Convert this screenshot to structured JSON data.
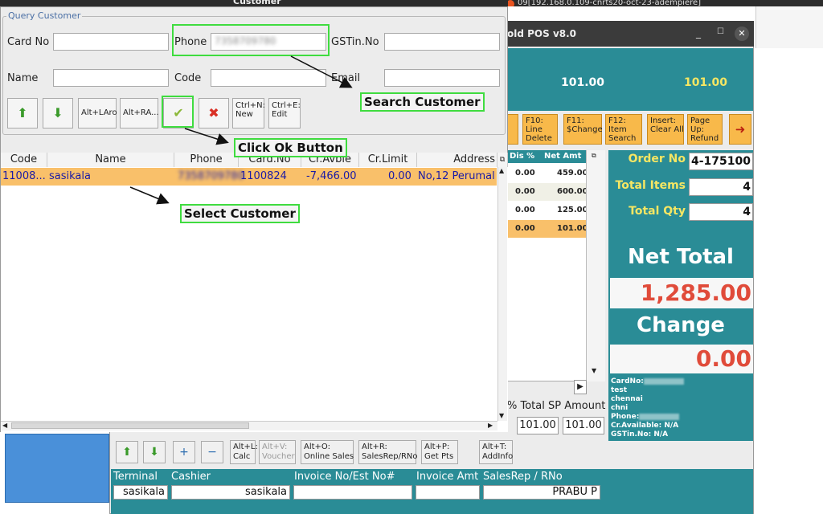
{
  "dialog": {
    "title": "Customer",
    "group_label": "Query Customer",
    "fields": {
      "card_no_label": "Card No",
      "phone_label": "Phone",
      "phone_value": "7358709780",
      "gstin_label": "GSTin.No",
      "name_label": "Name",
      "code_label": "Code",
      "email_label": "Email"
    },
    "toolbar": {
      "alt_larrow": "Alt+LAro",
      "alt_ra": "Alt+RA...",
      "new": "Ctrl+N:\nNew",
      "edit": "Ctrl+E:\nEdit"
    },
    "table": {
      "headers": [
        "Code",
        "Name",
        "Phone",
        "Card.No",
        "Cr.Avble",
        "Cr.Limit",
        "Address"
      ],
      "row": {
        "code": "11008...",
        "name": "sasikala",
        "phone": "7358709780",
        "card_no": "1100824",
        "cr_avble": "-7,466.00",
        "cr_limit": "0.00",
        "address": "No,12 Perumal"
      }
    }
  },
  "annotations": {
    "search_customer": "Search Customer",
    "click_ok": "Click Ok Button",
    "select_customer": "Select Customer"
  },
  "background": {
    "title": "09[192.168.0.109-cnrts20-oct-23-adempiere]"
  },
  "pos": {
    "title": "old POS v8.0",
    "teal_val1": "101.00",
    "teal_val2": "101.00",
    "fkeys": {
      "line_delete": "F10:\nLine\nDelete",
      "change": "F11:\n$Change",
      "item_search": "F12:\nItem\nSearch",
      "clear_all": "Insert:\nClear All",
      "refund": "Page\nUp:\nRefund"
    },
    "table_headers": [
      "Dis %",
      "Net Amt"
    ],
    "rows": [
      {
        "dis": "0.00",
        "net": "459.00"
      },
      {
        "dis": "0.00",
        "net": "600.00"
      },
      {
        "dis": "0.00",
        "net": "125.00"
      },
      {
        "dis": "0.00",
        "net": "101.00"
      }
    ],
    "order_no_label": "Order No",
    "order_no_value": "4-175100",
    "total_items_label": "Total Items",
    "total_items_value": "4",
    "total_qty_label": "Total Qty",
    "total_qty_value": "4",
    "net_total_label": "Net Total",
    "net_total_value": "1,285.00",
    "change_label": "Change",
    "change_value": "0.00",
    "info": {
      "card_no_label": "CardNo:",
      "line1": "test",
      "line2": "chennai",
      "line3": "chni",
      "phone_label": "Phone:",
      "cr_available": "Cr.Available: N/A",
      "gstin": "GSTin.No: N/A"
    },
    "total_sp_label": "% Total SP Amount",
    "sp_val1": "101.00",
    "sp_val2": "101.00",
    "bottom_buttons": {
      "calc": "Alt+L:\nCalc",
      "voucher": "Alt+V:\nVoucher",
      "online_sales": "Alt+O:\nOnline Sales",
      "salesrep": "Alt+R:\nSalesRep/RNo",
      "get_pts": "Alt+P:\nGet Pts",
      "add_info": "Alt+T:\nAddInfo"
    },
    "footer": {
      "terminal_label": "Terminal",
      "cashier_label": "Cashier",
      "invoice_no_label": "Invoice No/Est No#",
      "invoice_amt_label": "Invoice Amt",
      "salesrep_label": "SalesRep / RNo",
      "terminal_value": "sasikala",
      "cashier_value": "sasikala",
      "salesrep_value": "PRABU P"
    }
  },
  "colors": {
    "teal": "#2a8c96",
    "highlight_row": "#f9c06a",
    "annotation_border": "#3fdc3f",
    "net_total_red": "#e04b3a",
    "fkey_orange": "#f8b94a"
  }
}
